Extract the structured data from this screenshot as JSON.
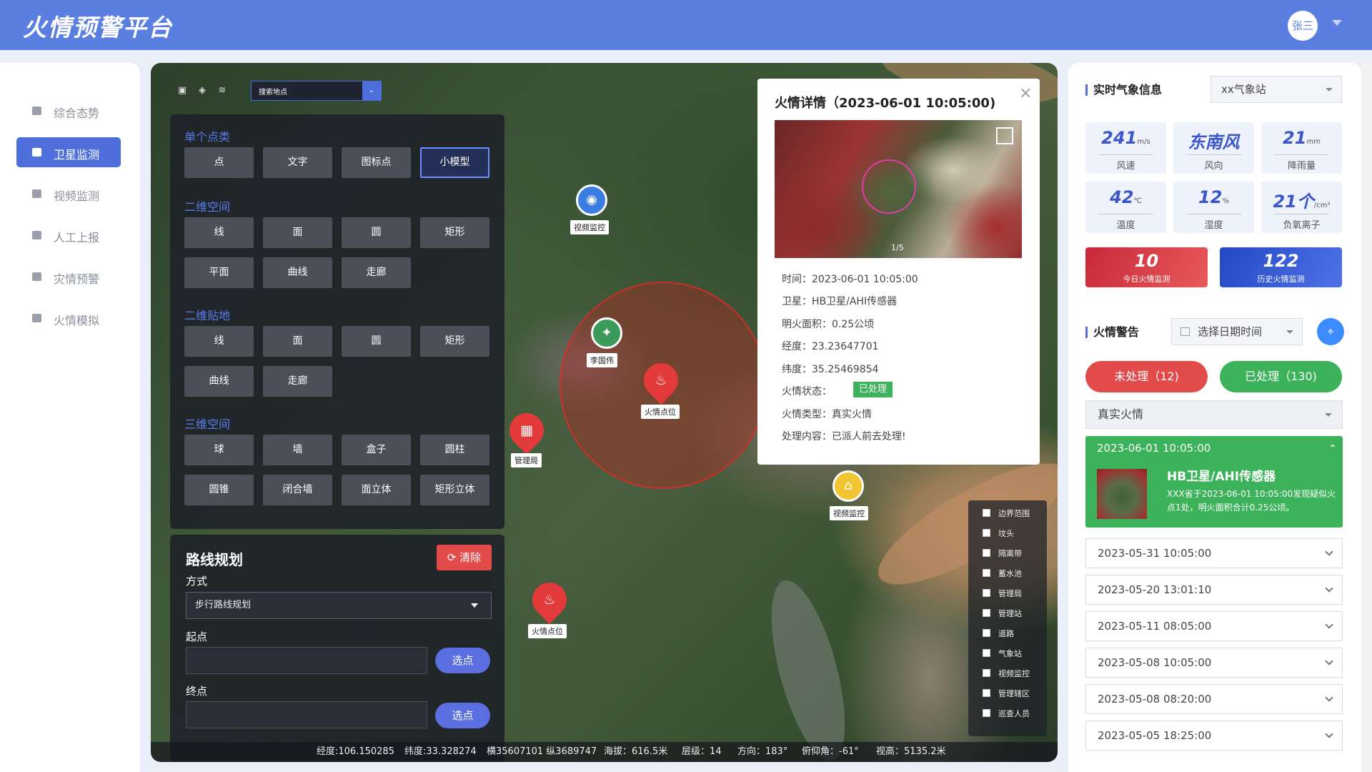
{
  "header": {
    "title": "火情预警平台",
    "user": "张三"
  },
  "nav": {
    "items": [
      {
        "label": "综合态势"
      },
      {
        "label": "卫星监测"
      },
      {
        "label": "视频监测"
      },
      {
        "label": "人工上报"
      },
      {
        "label": "灾情预警"
      },
      {
        "label": "火情模拟"
      }
    ],
    "active": "卫星监测"
  },
  "map": {
    "search_value": "搜索地点",
    "draw_panel": {
      "sections": [
        {
          "title": "单个点类",
          "buttons": [
            "点",
            "文字",
            "图标点",
            "小模型"
          ]
        },
        {
          "title": "二维空间",
          "buttons": [
            "线",
            "面",
            "圆",
            "矩形",
            "平面",
            "曲线",
            "走廊"
          ]
        },
        {
          "title": "二维贴地",
          "buttons": [
            "线",
            "面",
            "圆",
            "矩形",
            "曲线",
            "走廊"
          ]
        },
        {
          "title": "三维空间",
          "buttons": [
            "球",
            "墙",
            "盒子",
            "圆柱",
            "圆锥",
            "闭合墙",
            "面立体",
            "矩形立体"
          ]
        }
      ],
      "selected": "小模型"
    },
    "route": {
      "title": "路线规划",
      "clear": "清除",
      "mode_label": "方式",
      "mode_value": "步行路线规划",
      "start_label": "起点",
      "end_label": "终点",
      "pick": "选点"
    },
    "markers": {
      "video1": "视频监控",
      "person": "李国伟",
      "fire1": "火情点位",
      "bureau": "管理局",
      "video2": "视频监控",
      "fire2": "火情点位"
    },
    "layers": [
      "边界范围",
      "坟头",
      "隔离带",
      "蓄水池",
      "管理局",
      "管理站",
      "道路",
      "气象站",
      "视频监控",
      "管理辖区",
      "巡查人员"
    ],
    "status": {
      "lon": "经度:106.150285",
      "lat": "纬度:33.328274",
      "xy": "横35607101 纵3689747",
      "alt": "海拔：616.5米",
      "level": "层级：14",
      "heading": "方向：183°",
      "pitch": "俯仰角：-61°",
      "height": "视高：5135.2米"
    }
  },
  "popup": {
    "title": "火情详情（2023-06-01 10:05:00)",
    "pager": "1/5",
    "rows": {
      "time": "时间：2023-06-01 10:05:00",
      "sat": "卫星：HB卫星/AHI传感器",
      "area": "明火面积：0.25公顷",
      "lon": "经度：23.23647701",
      "lat": "纬度：35.25469854",
      "status_label": "火情状态：",
      "status_value": "已处理",
      "type": "火情类型：真实火情",
      "content": "处理内容：已派人前去处理!"
    }
  },
  "weather": {
    "title": "实时气象信息",
    "station": "xx气象站",
    "items": [
      {
        "value": "241",
        "unit": "m/s",
        "label": "风速"
      },
      {
        "value": "东南风",
        "unit": "",
        "label": "风向"
      },
      {
        "value": "21",
        "unit": "mm",
        "label": "降雨量"
      },
      {
        "value": "42",
        "unit": "℃",
        "label": "温度"
      },
      {
        "value": "12",
        "unit": "%",
        "label": "湿度"
      },
      {
        "value": "21个",
        "unit": "/cm³",
        "label": "负氧离子"
      }
    ],
    "today": {
      "value": "10",
      "label": "今日火情监测"
    },
    "history": {
      "value": "122",
      "label": "历史火情监测"
    }
  },
  "alerts": {
    "title": "火情警告",
    "date_placeholder": "选择日期时间",
    "pending": "未处理（12)",
    "done": "已处理（130)",
    "type": "真实火情",
    "open": {
      "time": "2023-06-01 10:05:00",
      "title": "HB卫星/AHI传感器",
      "desc": "XXX省于2023-06-01  10:05:00发现疑似火点1处，明火面积合计0.25公顷。"
    },
    "items": [
      "2023-05-31 10:05:00",
      "2023-05-20 13:01:10",
      "2023-05-11 08:05:00",
      "2023-05-08 10:05:00",
      "2023-05-08 08:20:00",
      "2023-05-05 18:25:00"
    ]
  },
  "colors": {
    "brand": "#5b7fe0",
    "danger": "#e34b4b",
    "success": "#3cb35a"
  }
}
